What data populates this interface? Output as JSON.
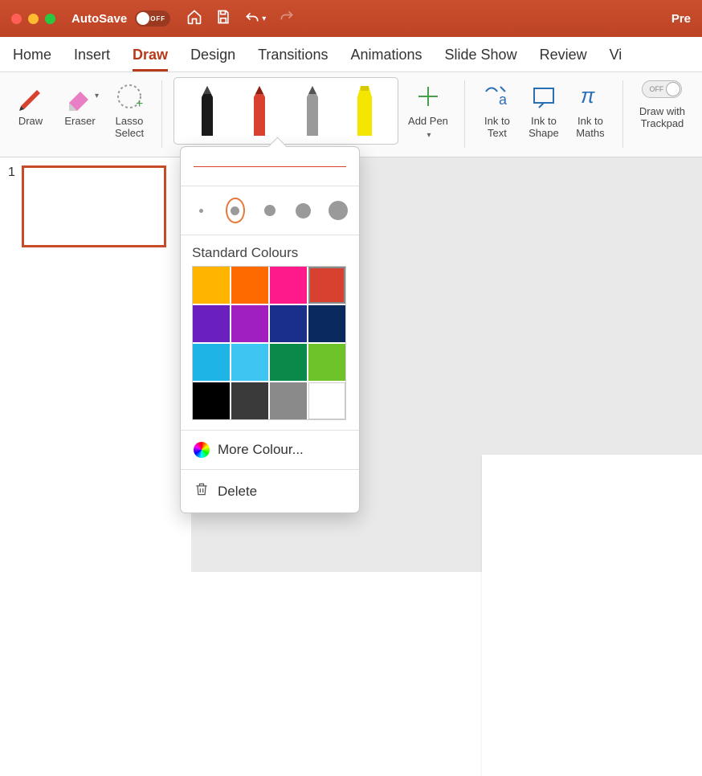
{
  "title": "Pre",
  "autosave": {
    "label": "AutoSave",
    "state": "OFF"
  },
  "tabs": [
    "Home",
    "Insert",
    "Draw",
    "Design",
    "Transitions",
    "Animations",
    "Slide Show",
    "Review",
    "Vi"
  ],
  "active_tab": "Draw",
  "ribbon": {
    "draw": "Draw",
    "eraser": "Eraser",
    "lasso": "Lasso\nSelect",
    "addpen": "Add Pen",
    "inktext": "Ink to\nText",
    "inkshape": "Ink to\nShape",
    "inkmath": "Ink to\nMaths",
    "trackpad": "Draw with\nTrackpad",
    "trackpad_state": "OFF"
  },
  "slide_number": "1",
  "popover": {
    "section_label": "Standard Colours",
    "more": "More Colour...",
    "delete": "Delete",
    "selected_size_index": 1,
    "selected_color_index": 3,
    "colors": [
      "#ffb400",
      "#ff6a00",
      "#ff1a8c",
      "#d8412f",
      "#6a1fbf",
      "#a01fbf",
      "#1a2f8a",
      "#0a2a5e",
      "#1fb4e6",
      "#3fc5f2",
      "#0a8a4a",
      "#6ec22a",
      "#000000",
      "#3a3a3a",
      "#8a8a8a",
      "#ffffff"
    ]
  }
}
